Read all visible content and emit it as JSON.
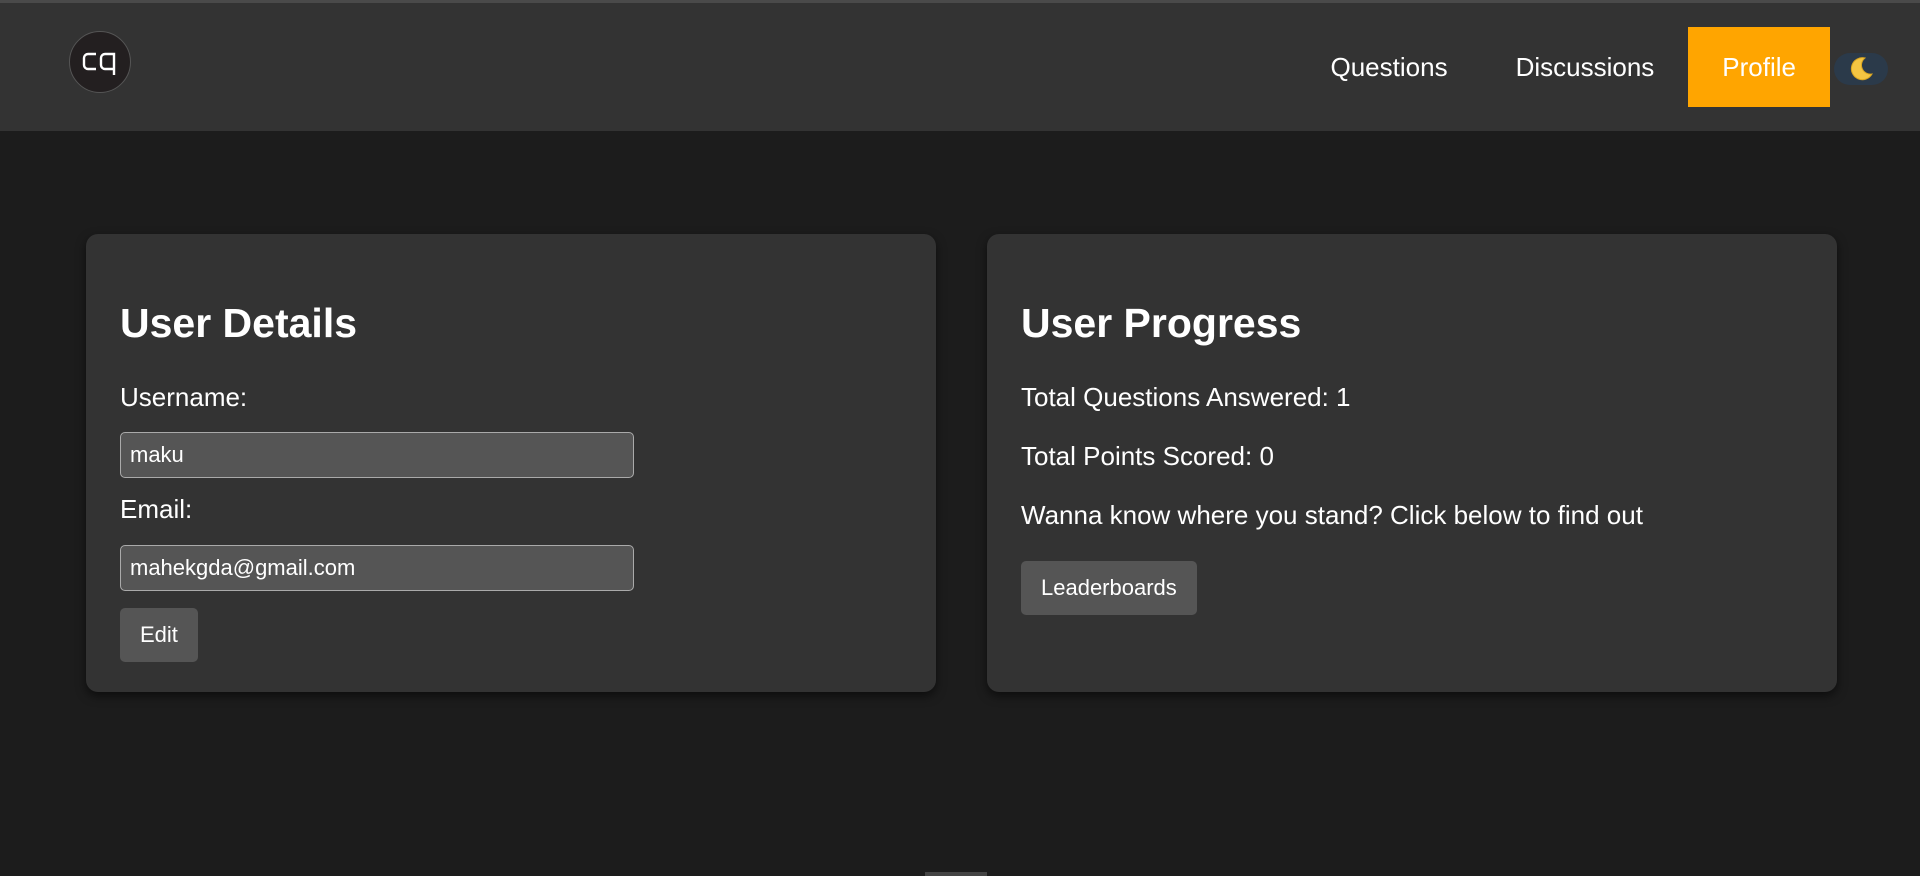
{
  "header": {
    "logo_text": "cq",
    "nav": [
      "Questions",
      "Discussions",
      "Profile"
    ],
    "active_nav": "Profile",
    "theme_icon": "moon-icon"
  },
  "user_details": {
    "title": "User Details",
    "username_label": "Username:",
    "username_value": "maku",
    "email_label": "Email:",
    "email_value": "mahekgda@gmail.com",
    "edit_label": "Edit"
  },
  "user_progress": {
    "title": "User Progress",
    "questions_answered": "Total Questions Answered: 1",
    "points_scored": "Total Points Scored: 0",
    "prompt": "Wanna know where you stand? Click below to find out",
    "leaderboards_label": "Leaderboards"
  },
  "colors": {
    "accent": "#ffa500",
    "navbar": "#333333",
    "background": "#1c1c1c",
    "card": "#333333"
  }
}
